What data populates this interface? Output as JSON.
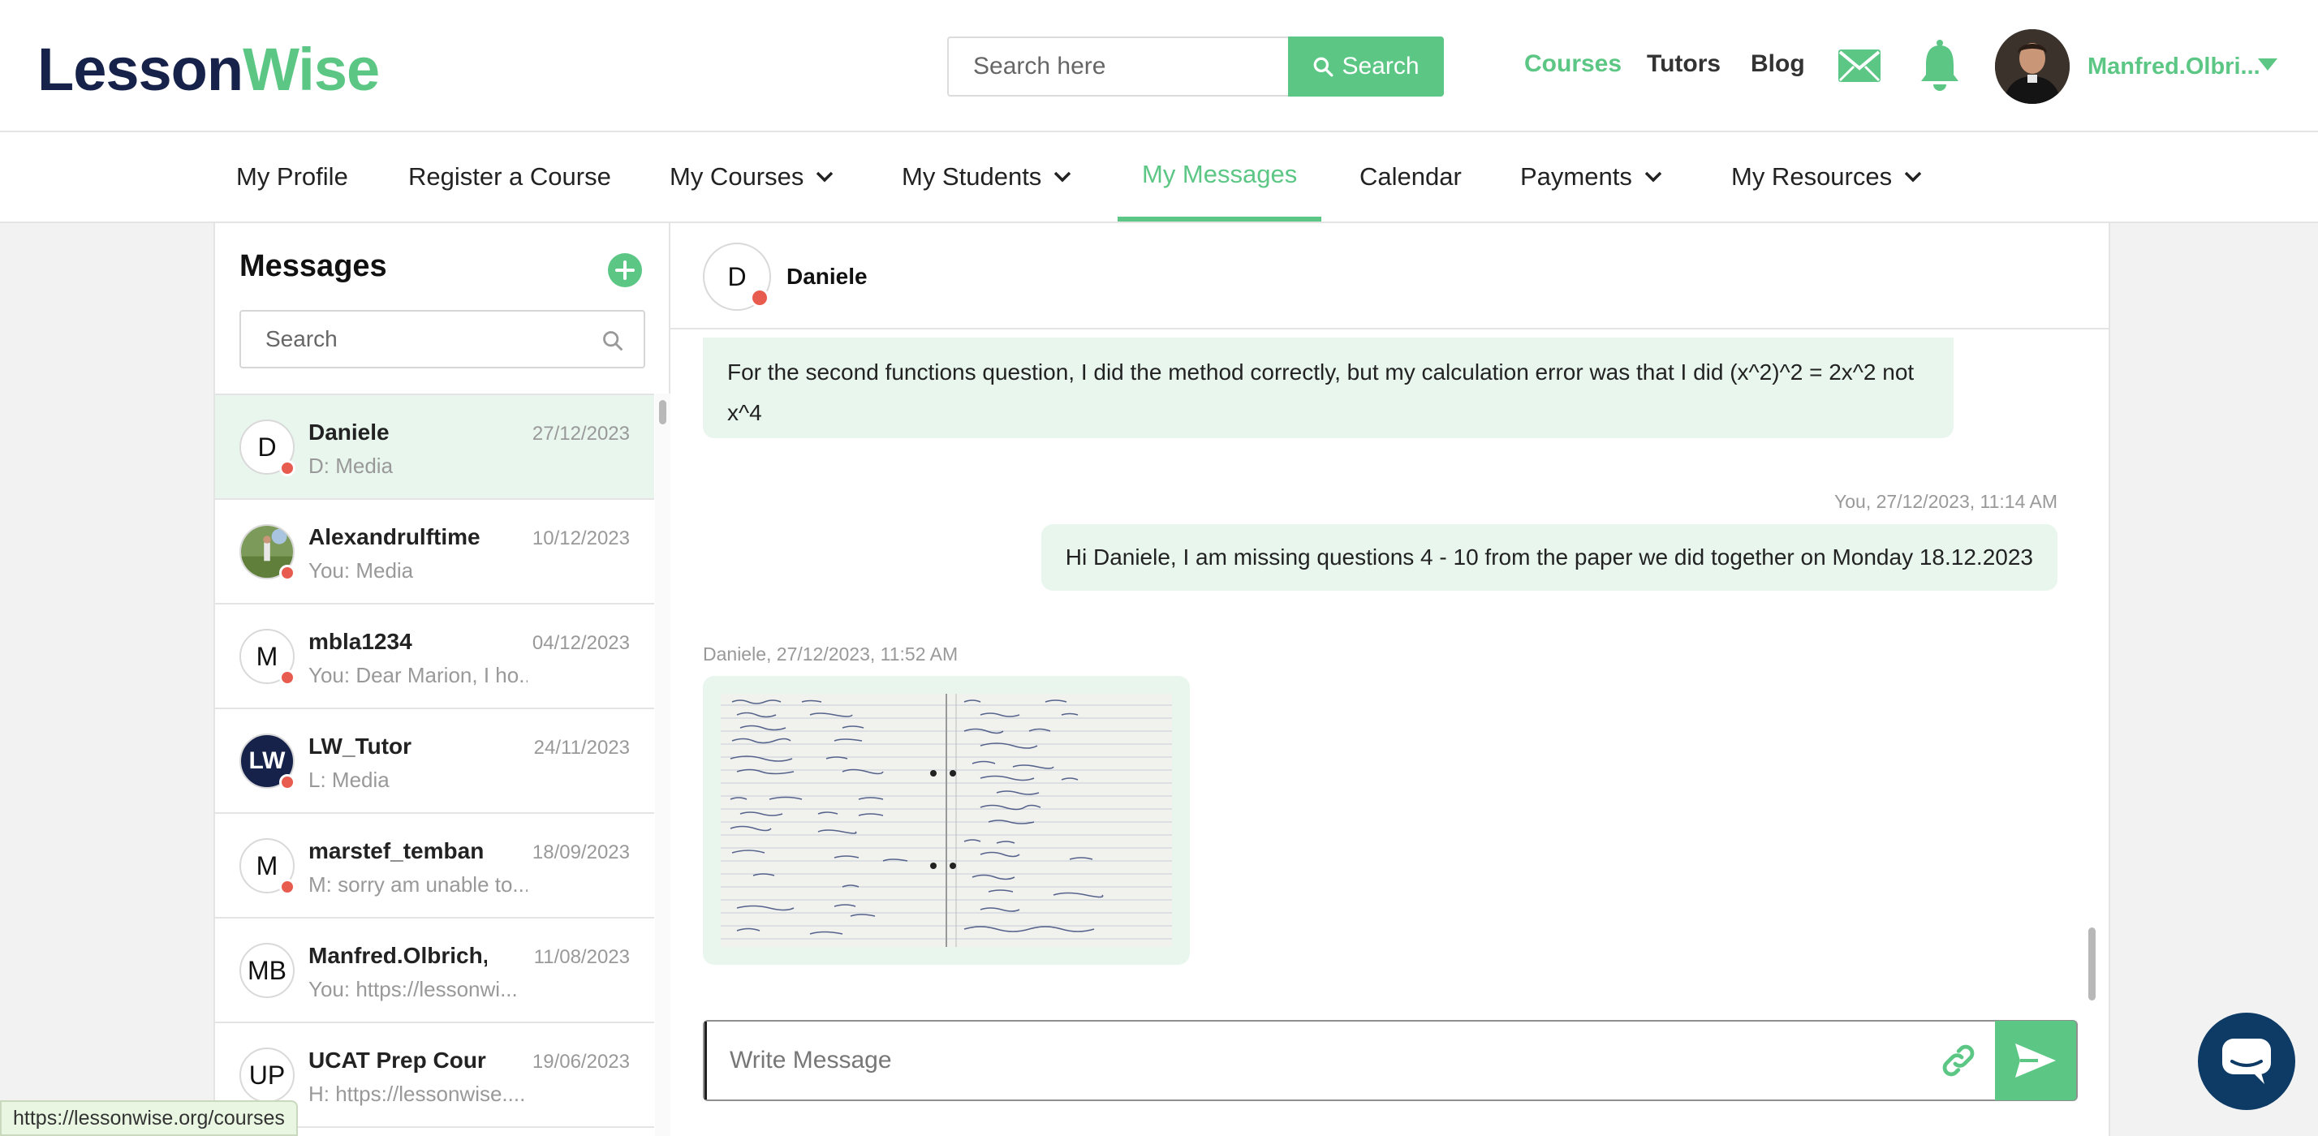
{
  "brand": {
    "logo_part1": "Lesson",
    "logo_part2": "Wise"
  },
  "search": {
    "placeholder": "Search here",
    "button_label": "Search"
  },
  "top_nav": {
    "courses": "Courses",
    "tutors": "Tutors",
    "blog": "Blog"
  },
  "user": {
    "display_name": "Manfred.Olbri..."
  },
  "sub_nav": [
    {
      "label": "My Profile"
    },
    {
      "label": "Register a Course"
    },
    {
      "label": "My Courses"
    },
    {
      "label": "My Students"
    },
    {
      "label": "My Messages"
    },
    {
      "label": "Calendar"
    },
    {
      "label": "Payments"
    },
    {
      "label": "My Resources"
    }
  ],
  "messages_panel": {
    "title": "Messages",
    "search_placeholder": "Search",
    "conversations": [
      {
        "initials": "D",
        "name": "Daniele",
        "date": "27/12/2023",
        "preview": "D: Media",
        "active": true
      },
      {
        "initials": "",
        "name": "Alexandrulftime",
        "date": "10/12/2023",
        "preview": "You: Media"
      },
      {
        "initials": "M",
        "name": "mbla1234",
        "date": "04/12/2023",
        "preview": "You: Dear Marion, I ho..."
      },
      {
        "initials": "LW",
        "name": "LW_Tutor",
        "date": "24/11/2023",
        "preview": "L: Media"
      },
      {
        "initials": "M",
        "name": "marstef_temban",
        "date": "18/09/2023",
        "preview": "M: sorry am unable to..."
      },
      {
        "initials": "MB",
        "name": "Manfred.Olbrich, ...",
        "date": "11/08/2023",
        "preview": "You: https://lessonwi..."
      },
      {
        "initials": "UP",
        "name": "UCAT Prep Cours...",
        "date": "19/06/2023",
        "preview": "H: https://lessonwise...."
      }
    ]
  },
  "chat": {
    "contact_initial": "D",
    "contact_name": "Daniele",
    "messages": [
      {
        "direction": "in",
        "text": "For the second functions question, I did the method correctly, but my calculation error was that I did (x^2)^2 = 2x^2 not x^4"
      },
      {
        "direction": "out",
        "meta": "You, 27/12/2023, 11:14 AM",
        "text": "Hi Daniele, I am missing questions 4 - 10 from the paper we did together on Monday 18.12.2023"
      },
      {
        "direction": "in",
        "meta": "Daniele, 27/12/2023, 11:52 AM",
        "attachment": "handwritten-notes-photo"
      }
    ],
    "composer_placeholder": "Write Message"
  },
  "status_bar_url": "https://lessonwise.org/courses",
  "colors": {
    "brand_green": "#5cc785",
    "brand_navy": "#16224a",
    "bubble_bg": "#e8f6ee",
    "status_dot": "#e85b4f"
  }
}
